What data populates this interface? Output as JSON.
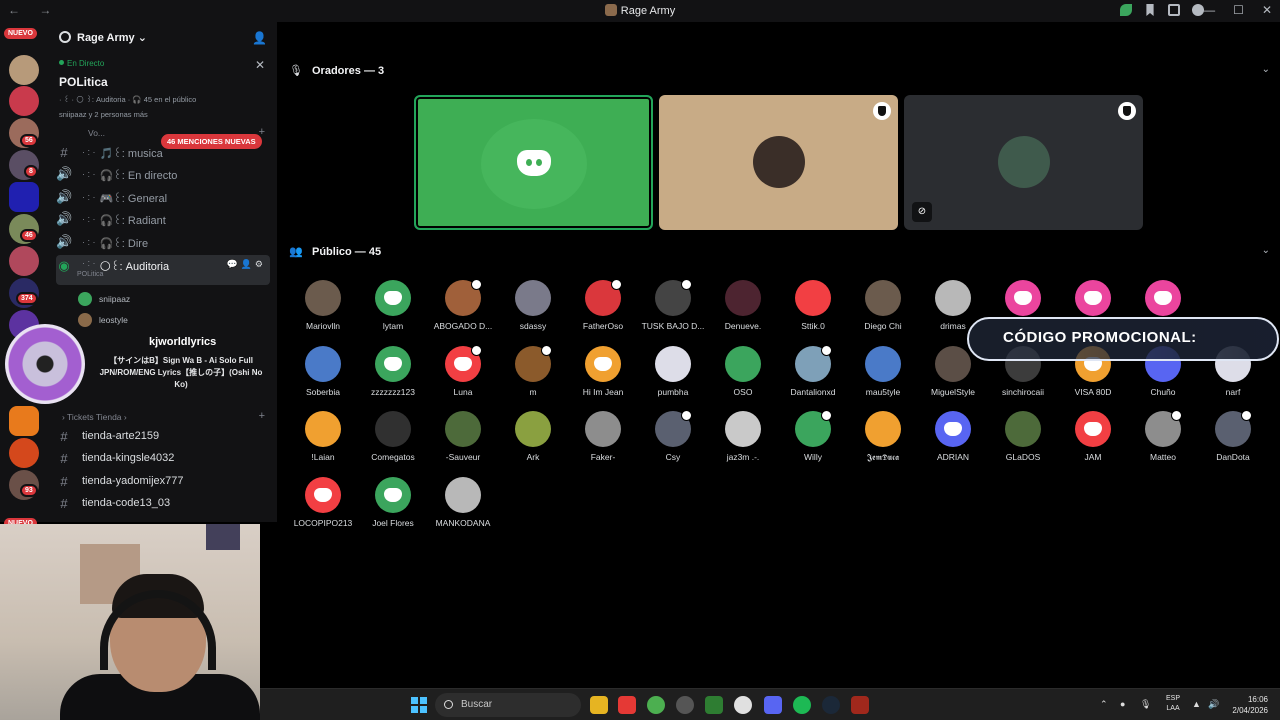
{
  "window": {
    "title": "Rage Army",
    "nav": "← →",
    "controls": [
      "—",
      "☐",
      "✕"
    ]
  },
  "rail": {
    "nuevo_top": "NUEVO",
    "nuevo_bottom": "NUEVO",
    "badges": [
      "56",
      "8",
      "46",
      "374",
      "93"
    ]
  },
  "server": {
    "name": "Rage Army",
    "chevron": "⌄"
  },
  "live": {
    "status": "En Directo",
    "topic": "POLitica",
    "meta": "· ꒰ · 🌕 ꒱: Auditoria · 🎧 45 en el público",
    "people": "sniipaaz y 2 personas más"
  },
  "channels": {
    "mentions_pill": "46 MENCIONES NUEVAS",
    "voice_cut": "Vo...",
    "items": [
      {
        "prefix": "· : ·",
        "label": "🎵꒰: musica"
      },
      {
        "prefix": "· : ·",
        "label": "🎧꒰: En directo"
      },
      {
        "prefix": "· : ·",
        "label": "🎮꒰: General"
      },
      {
        "prefix": "· : ·",
        "label": "🎧꒰: Radiant"
      },
      {
        "prefix": "· : ·",
        "label": "🎧꒰: Dire"
      }
    ],
    "active": {
      "prefix": "· : ·",
      "label": "🌕꒰: Auditoria",
      "sub": "POLitica"
    },
    "connected": [
      "sniipaaz",
      "leostyle"
    ],
    "category": "Tickets Tienda",
    "shops": [
      "tienda-arte2159",
      "tienda-kingsle4032",
      "tienda-yadomijex777",
      "tienda-code13_03"
    ]
  },
  "music": {
    "artist": "kjworldlyrics",
    "song": "【サインはB】Sign Wa B - Ai Solo Full JPN/ROM/ENG Lyrics【推しの子】(Oshi No Ko)"
  },
  "stage": {
    "speakers_title": "Oradores — 3",
    "audience_title": "Público — 45",
    "promo": "CÓDIGO PROMOCIONAL:",
    "audience": [
      [
        "Mariovlln",
        "lytam",
        "ABOGADO D...",
        "sdassy",
        "FatherOso",
        "TUSK BAJO D...",
        "Denueve.",
        "Sttik.0",
        "Diego Chi",
        "drimas",
        "",
        "",
        ""
      ],
      [
        "Soberbia",
        "zzzzzzz123",
        "Luna",
        "m",
        "Hi Im Jean",
        "pumbha",
        "OSO",
        "Dantalionxd",
        "mau5tyle",
        "MiguelStyle",
        "sinchirocaii",
        "VISA 80D",
        "Chuño",
        "narf"
      ],
      [
        "!Laian",
        "Comegatos",
        "-Sauveur",
        "Ark",
        "Faker-",
        "Csy",
        "jaz3m .-.",
        "Willy",
        "𝕵𝖊𝖒𝕯𝖚𝖈𝖆",
        "ADRIAN",
        "GLaDOS",
        "JAM",
        "Matteo",
        "DanDota"
      ],
      [
        "LOCOPIPO213",
        "Joel Flores",
        "MANKODANA"
      ]
    ]
  },
  "taskbar": {
    "search": "Buscar",
    "lang": "ESP\nLAA",
    "time": "16:06",
    "date": "2/04/2026"
  }
}
